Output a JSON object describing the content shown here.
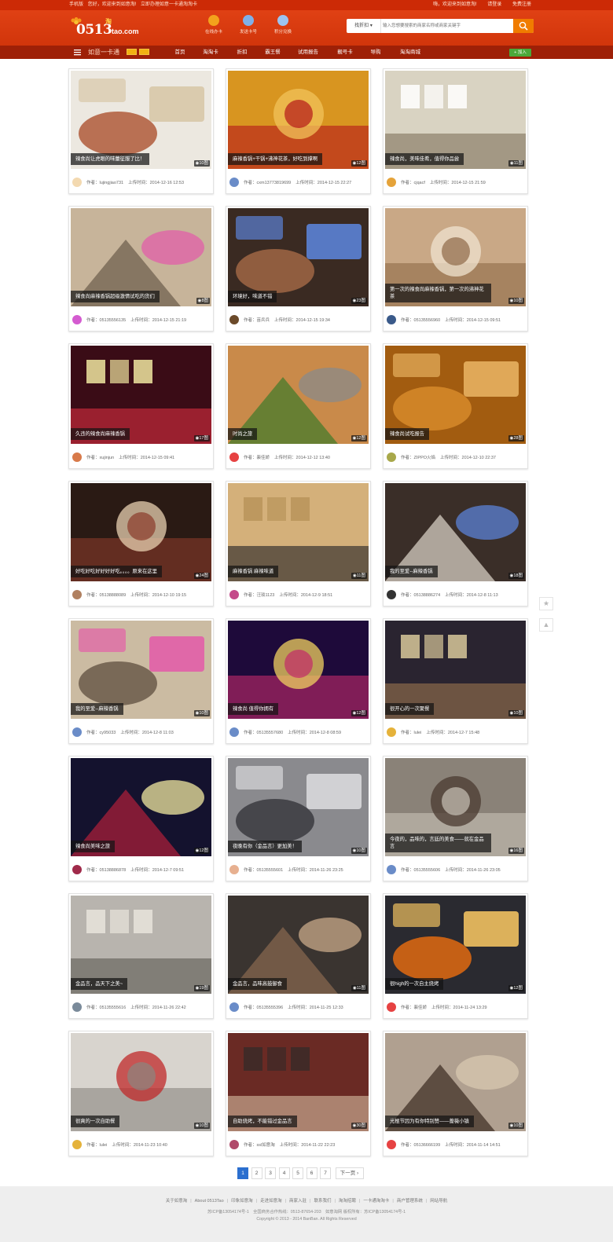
{
  "topbar": {
    "mobile": "手机版",
    "welcome": "您好，欢迎来到如意淘!",
    "apply": "立即办理如意一卡通淘淘卡",
    "greeting": "嗨，欢迎来到如意淘!",
    "login": "请登录",
    "register": "免费注册"
  },
  "header": {
    "logo_main": "0513",
    "logo_domain": "tao.com",
    "logo_cn": "淘",
    "icons": [
      {
        "label": "在线办卡",
        "icon": "card-icon",
        "color": "#f3a21c"
      },
      {
        "label": "发送卡号",
        "icon": "send-icon",
        "color": "#7fb0e8"
      },
      {
        "label": "积分兑换",
        "icon": "gift-icon",
        "color": "#9cc3f0"
      }
    ],
    "search": {
      "category": "找折扣",
      "placeholder": "输入您想要搜索的商家名称或商家关键字"
    }
  },
  "nav": {
    "brand": "如意一卡通",
    "items": [
      "首页",
      "淘淘卡",
      "折扣",
      "霸王餐",
      "试用报告",
      "靓号卡",
      "导购",
      "淘淘商城"
    ],
    "join": "+ 加入",
    "accent": "#9e2007"
  },
  "cards": [
    {
      "caption": "辣食尚让虎眼的味蕾征服了比！",
      "count": "10图",
      "author": "lujingjiao731",
      "time": "2014-12-16 12:53",
      "palette": [
        "#ece8e0",
        "#b05a3a",
        "#d8c8a8"
      ],
      "avatar": "#f3d9b0"
    },
    {
      "caption": "麻辣香锅+干锅+沸神花茶，好吃到撑啊",
      "count": "12图",
      "author": "cxm13773819699",
      "time": "2014-12-15 22:27",
      "palette": [
        "#d89520",
        "#b5181a",
        "#f2c35a"
      ],
      "avatar": "#6a8cc8"
    },
    {
      "caption": "辣食尚，美味佳肴，值得你品尝",
      "count": "11图",
      "author": "cjqacf",
      "time": "2014-12-15 21:59",
      "palette": [
        "#d9d3c2",
        "#8c7f6a",
        "#ffffff"
      ],
      "avatar": "#e5a33a"
    },
    {
      "caption": "辣食尚麻辣香锅超级激情试吃的货们",
      "count": "8图",
      "author": "05135556135",
      "time": "2014-12-15 21:19",
      "palette": [
        "#c7b49a",
        "#6b5b4a",
        "#e25fa8"
      ],
      "avatar": "#d45bd0"
    },
    {
      "caption": "环境好，味道不错",
      "count": "23图",
      "author": "苗兵兵",
      "time": "2014-12-15 19:34",
      "palette": [
        "#3a2a22",
        "#a06644",
        "#5b82d6"
      ],
      "avatar": "#6b4a2a"
    },
    {
      "caption": "第一次的辣食尚麻辣香锅，第一次的沸神花茶",
      "count": "10图",
      "author": "05135556960",
      "time": "2014-12-15 09:51",
      "palette": [
        "#c9a886",
        "#8f6a48",
        "#efe3cf"
      ],
      "avatar": "#3a5a8a"
    },
    {
      "caption": "久违的辣食尚麻辣香锅",
      "count": "17图",
      "author": "xujinjun",
      "time": "2014-12-15 09:41",
      "palette": [
        "#3a0c16",
        "#c32a3a",
        "#f0e6a0"
      ],
      "avatar": "#d87a4a"
    },
    {
      "caption": "时尚之旅",
      "count": "12图",
      "author": "裴佳娇",
      "time": "2014-12-12 13:40",
      "palette": [
        "#c98a4a",
        "#3d7a2a",
        "#8a8a8a"
      ],
      "avatar": "#e64242"
    },
    {
      "caption": "辣食尚试吃报告",
      "count": "28图",
      "author": "ZIPPO火焰",
      "time": "2014-12-10 22:37",
      "palette": [
        "#a25c10",
        "#d78a2a",
        "#e7b060"
      ],
      "avatar": "#a8a84a"
    },
    {
      "caption": "好吃好吃好好好好吃。。。。原来在这里",
      "count": "24图",
      "author": "05138888089",
      "time": "2014-12-10 19:15",
      "palette": [
        "#2a1a14",
        "#8a3a2a",
        "#e8d0b0"
      ],
      "avatar": "#b08060"
    },
    {
      "caption": "麻辣香锅 麻辣味道",
      "count": "11图",
      "author": "汪琰1123",
      "time": "2014-12-9 18:51",
      "palette": [
        "#d4b07a",
        "#3a3530",
        "#b8945a"
      ],
      "avatar": "#c44a8a"
    },
    {
      "caption": "我的至爱--麻辣香锅",
      "count": "18图",
      "author": "05138886274",
      "time": "2014-12-8 11:13",
      "palette": [
        "#3a2e28",
        "#e0d8cc",
        "#5b82d6"
      ],
      "avatar": "#333333"
    },
    {
      "caption": "我的至爱--麻辣香锅",
      "count": "10图",
      "author": "cy95033",
      "time": "2014-12-8 11:03",
      "palette": [
        "#cbbba2",
        "#6b5b4a",
        "#e25fa8"
      ],
      "avatar": "#6a8cc8"
    },
    {
      "caption": "辣食尚 值得你拥有",
      "count": "12图",
      "author": "05135557680",
      "time": "2014-12-8 08:59",
      "palette": [
        "#1e0a3a",
        "#c22a6a",
        "#f0d060"
      ],
      "avatar": "#6a8cc8"
    },
    {
      "caption": "很开心的一次聚餐",
      "count": "10图",
      "author": "lulei",
      "time": "2014-12-7 15:48",
      "palette": [
        "#2a2430",
        "#8a6a4a",
        "#d8c89a"
      ],
      "avatar": "#e5b23a"
    },
    {
      "caption": "辣食尚美味之旅",
      "count": "12图",
      "author": "05138886878",
      "time": "2014-12-7 09:51",
      "palette": [
        "#14122e",
        "#b0203a",
        "#f0e8a0"
      ],
      "avatar": "#a02a4a"
    },
    {
      "caption": "夜晚有你（金品言）更加美！",
      "count": "10图",
      "author": "05135555601",
      "time": "2014-11-26 23:25",
      "palette": [
        "#8a8a8e",
        "#3a3a40",
        "#d8d8dc"
      ],
      "avatar": "#e7b090"
    },
    {
      "caption": "今夜的，品味的，言廷的美食——就在金品言",
      "count": "16图",
      "author": "05135555606",
      "time": "2014-11-26 23:05",
      "palette": [
        "#8a8278",
        "#c8c2b6",
        "#4a3a30"
      ],
      "avatar": "#6a8cc8"
    },
    {
      "caption": "金品言，品天下之美~",
      "count": "19图",
      "author": "05135555616",
      "time": "2014-11-26 22:42",
      "palette": [
        "#b8b4ae",
        "#6a6660",
        "#e8e4dc"
      ],
      "avatar": "#7a8a9a"
    },
    {
      "caption": "金品言，品味高鼓御食",
      "count": "11图",
      "author": "05135555396",
      "time": "2014-11-25 12:33",
      "palette": [
        "#3a3430",
        "#8a6a50",
        "#c8a888"
      ],
      "avatar": "#6a8cc8"
    },
    {
      "caption": "很high的一次自主烧烤",
      "count": "12图",
      "author": "裴佳娇",
      "time": "2014-11-24 13:29",
      "palette": [
        "#2a2a30",
        "#e06a10",
        "#f0c060"
      ],
      "avatar": "#e64242"
    },
    {
      "caption": "很爽的一次自助餐",
      "count": "10图",
      "author": "lulei",
      "time": "2014-11-23 10:40",
      "palette": [
        "#d8d4ce",
        "#8a8680",
        "#c02a2a"
      ],
      "avatar": "#e5b23a"
    },
    {
      "caption": "自助烧烤，不能错过金品言",
      "count": "30图",
      "author": "ssl如意淘",
      "time": "2014-11-22 22:23",
      "palette": [
        "#6a2a24",
        "#c8a890",
        "#3a2a28"
      ],
      "avatar": "#b04a6a"
    },
    {
      "caption": "光棍节因为有你特别赞——蔷薇小镇",
      "count": "10图",
      "author": "05136666199",
      "time": "2014-11-14 14:51",
      "palette": [
        "#b0a090",
        "#3a2a20",
        "#d8c8b0"
      ],
      "avatar": "#e64242"
    }
  ],
  "labels": {
    "author": "作者：",
    "upload": "上传时间："
  },
  "sidetools": {
    "favorite": "★",
    "top": "▲"
  },
  "pagination": {
    "pages": [
      "1",
      "2",
      "3",
      "4",
      "5",
      "6",
      "7"
    ],
    "next": "下一页 ›",
    "current": "1"
  },
  "footer": {
    "links": [
      "关于如意淘",
      "About 0513Tao",
      "印象如意淘",
      "走进如意淘",
      "商家入驻",
      "联系我们",
      "淘淘招聘",
      "一卡通淘淘卡",
      "商户管理系统",
      "网站导航"
    ],
    "line1": "苏ICP备13054174号-1　全国商务合作热线：0513-87654-203　如意淘网 版权所有：苏ICP备13054174号-1",
    "copyright": "Copyright © 2013 - 2014 BanBan. All Rights Reserved"
  }
}
